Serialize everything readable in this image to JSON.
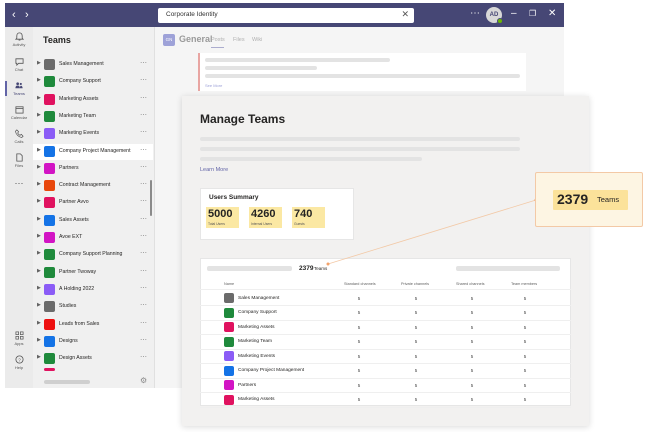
{
  "titlebar": {
    "search_value": "Corporate Identity",
    "avatar_initials": "AD",
    "back_icon": "chevron-left-icon",
    "forward_icon": "chevron-right-icon"
  },
  "rail": [
    {
      "label": "Activity",
      "icon": "bell-icon"
    },
    {
      "label": "Chat",
      "icon": "chat-icon"
    },
    {
      "label": "Teams",
      "icon": "teams-icon"
    },
    {
      "label": "Calendar",
      "icon": "calendar-icon"
    },
    {
      "label": "Calls",
      "icon": "phone-icon"
    },
    {
      "label": "Files",
      "icon": "file-icon"
    },
    {
      "label": "Apps",
      "icon": "apps-icon"
    },
    {
      "label": "Help",
      "icon": "help-icon"
    }
  ],
  "teams_panel": {
    "header": "Teams",
    "teams": [
      {
        "name": "Sales Management",
        "color": "#6b6b6b"
      },
      {
        "name": "Company Support",
        "color": "#1f8a3c"
      },
      {
        "name": "Marketing Assets",
        "color": "#e0125f"
      },
      {
        "name": "Marketing Team",
        "color": "#1f8a3c"
      },
      {
        "name": "Marketing Events",
        "color": "#8b5cf6"
      },
      {
        "name": "Company Project Management",
        "color": "#1473e6"
      },
      {
        "name": "Partners",
        "color": "#d214c4"
      },
      {
        "name": "Contract Management",
        "color": "#e8470c"
      },
      {
        "name": "Partner Avvo",
        "color": "#e0125f"
      },
      {
        "name": "Sales Assets",
        "color": "#1473e6"
      },
      {
        "name": "Avoe EXT",
        "color": "#d214c4"
      },
      {
        "name": "Company Support Planning",
        "color": "#1f8a3c"
      },
      {
        "name": "Partner Twoway",
        "color": "#1f8a3c"
      },
      {
        "name": "A Holding 2022",
        "color": "#8b5cf6"
      },
      {
        "name": "Studies",
        "color": "#6b6b6b"
      },
      {
        "name": "Leads from Sales",
        "color": "#ee1010"
      },
      {
        "name": "Designs",
        "color": "#1473e6"
      },
      {
        "name": "Design Assets",
        "color": "#1f8a3c"
      }
    ]
  },
  "channel": {
    "avatar": "GN",
    "title": "General",
    "tabs": [
      "Posts",
      "Files",
      "Wiki"
    ],
    "see_more": "See More"
  },
  "manage": {
    "title": "Manage Teams",
    "learn_more": "Learn More",
    "summary_title": "Users Summary",
    "stats": [
      {
        "value": "5000",
        "label": "Total Users"
      },
      {
        "value": "4260",
        "label": "Internal Users"
      },
      {
        "value": "740",
        "label": "Guests"
      }
    ],
    "callout_count": "2379",
    "callout_label": "Teams",
    "table_count": "2379",
    "table_count_label": "Teams",
    "columns": [
      "Name",
      "Standard channels",
      "Private channels",
      "Shared channels",
      "Team members"
    ],
    "rows": [
      {
        "name": "Sales Management",
        "color": "#6b6b6b",
        "v": [
          "5",
          "5",
          "5",
          "5"
        ]
      },
      {
        "name": "Company Support",
        "color": "#1f8a3c",
        "v": [
          "5",
          "5",
          "5",
          "5"
        ]
      },
      {
        "name": "Marketing Assets",
        "color": "#e0125f",
        "v": [
          "5",
          "5",
          "5",
          "5"
        ]
      },
      {
        "name": "Marketing Team",
        "color": "#1f8a3c",
        "v": [
          "5",
          "5",
          "5",
          "5"
        ]
      },
      {
        "name": "Marketing Events",
        "color": "#8b5cf6",
        "v": [
          "5",
          "5",
          "5",
          "5"
        ]
      },
      {
        "name": "Company Project Management",
        "color": "#1473e6",
        "v": [
          "5",
          "5",
          "5",
          "5"
        ]
      },
      {
        "name": "Partners",
        "color": "#d214c4",
        "v": [
          "5",
          "5",
          "5",
          "5"
        ]
      },
      {
        "name": "Marketing Assets",
        "color": "#e0125f",
        "v": [
          "5",
          "5",
          "5",
          "5"
        ]
      }
    ]
  },
  "colors": {
    "accent": "#6264a7",
    "titlebar": "#464775",
    "highlight": "#fbe29a"
  }
}
